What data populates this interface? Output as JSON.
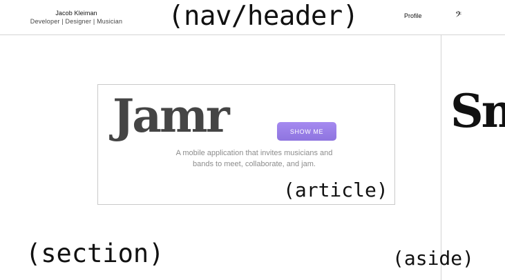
{
  "header": {
    "brand_name": "Jacob Kleiman",
    "brand_tagline": "Developer | Designer | Musician",
    "annotation": "(nav/header)",
    "nav_profile": "Profile",
    "clef_icon": "bass-clef-icon",
    "clef_glyph": "𝄢"
  },
  "article": {
    "title": "Jamr",
    "button_label": "SHOW ME",
    "description": "A mobile application that invites musicians and bands to meet, collaborate, and jam.",
    "annotation": "(article)",
    "button_color": "#9b7fe6"
  },
  "section": {
    "annotation": "(section)"
  },
  "aside": {
    "title": "Sn",
    "annotation": "(aside)"
  }
}
